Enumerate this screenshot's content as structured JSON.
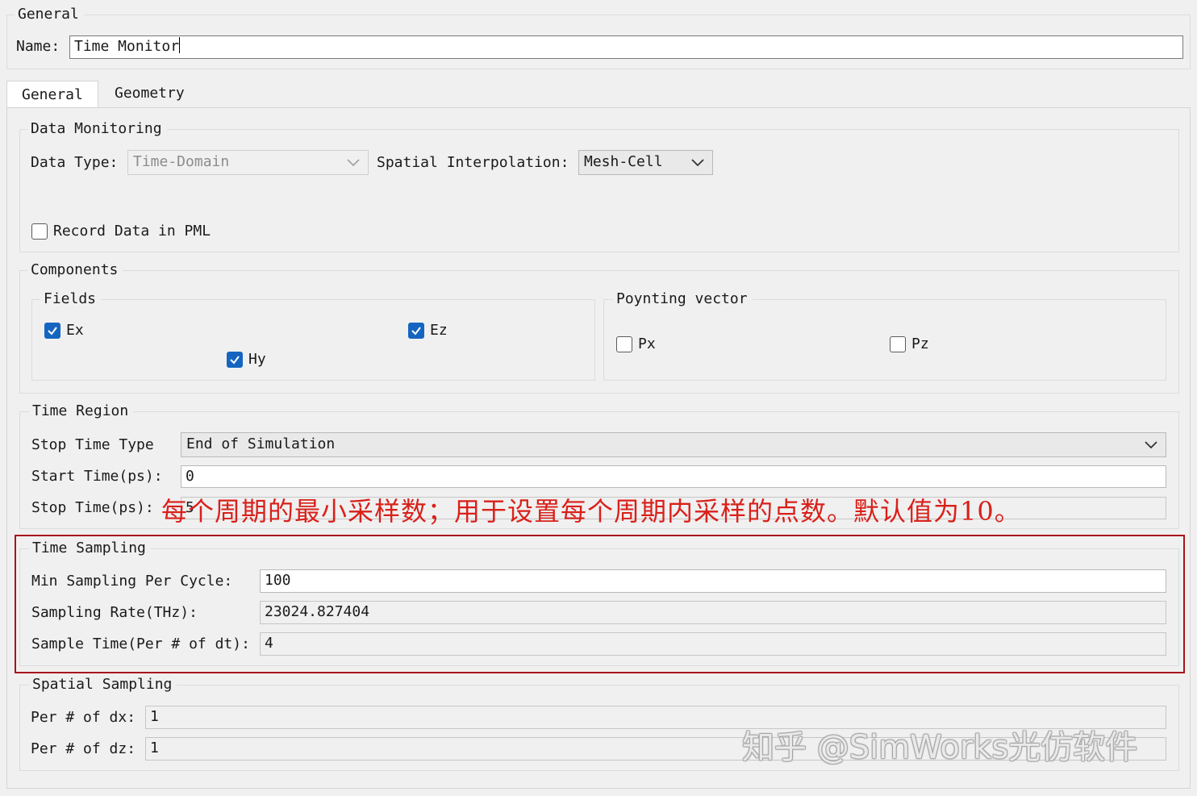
{
  "general_section": {
    "legend": "General",
    "name_label": "Name:",
    "name_value": "Time Monitor"
  },
  "tabs": [
    {
      "label": "General",
      "active": true
    },
    {
      "label": "Geometry",
      "active": false
    }
  ],
  "data_monitoring": {
    "legend": "Data Monitoring",
    "data_type_label": "Data Type:",
    "data_type_value": "Time-Domain",
    "spatial_interp_label": "Spatial Interpolation:",
    "spatial_interp_value": "Mesh-Cell",
    "record_pml_label": "Record Data in PML",
    "record_pml_checked": false
  },
  "components": {
    "legend": "Components",
    "fields": {
      "legend": "Fields",
      "ex": {
        "label": "Ex",
        "checked": true
      },
      "ez": {
        "label": "Ez",
        "checked": true
      },
      "hy": {
        "label": "Hy",
        "checked": true
      }
    },
    "poynting": {
      "legend": "Poynting vector",
      "px": {
        "label": "Px",
        "checked": false
      },
      "pz": {
        "label": "Pz",
        "checked": false
      }
    }
  },
  "time_region": {
    "legend": "Time Region",
    "stop_type_label": "Stop Time Type",
    "stop_type_value": "End of Simulation",
    "start_time_label": "Start Time(ps):",
    "start_time_value": "0",
    "stop_time_label": "Stop Time(ps):",
    "stop_time_value": "5"
  },
  "annotation": "每个周期的最小采样数；用于设置每个周期内采样的点数。默认值为10。",
  "time_sampling": {
    "legend": "Time Sampling",
    "min_sampling_label": "Min Sampling Per Cycle:",
    "min_sampling_value": "100",
    "sampling_rate_label": "Sampling Rate(THz):",
    "sampling_rate_value": "23024.827404",
    "sample_time_label": "Sample Time(Per # of dt):",
    "sample_time_value": "4"
  },
  "spatial_sampling": {
    "legend": "Spatial Sampling",
    "dx_label": "Per # of dx:",
    "dx_value": "1",
    "dz_label": "Per # of dz:",
    "dz_value": "1"
  },
  "watermark": "知乎 @SimWorks光仿软件",
  "colors": {
    "accent": "#1565c0",
    "annotation": "#d9201a",
    "highlight_box": "#a8131a"
  }
}
